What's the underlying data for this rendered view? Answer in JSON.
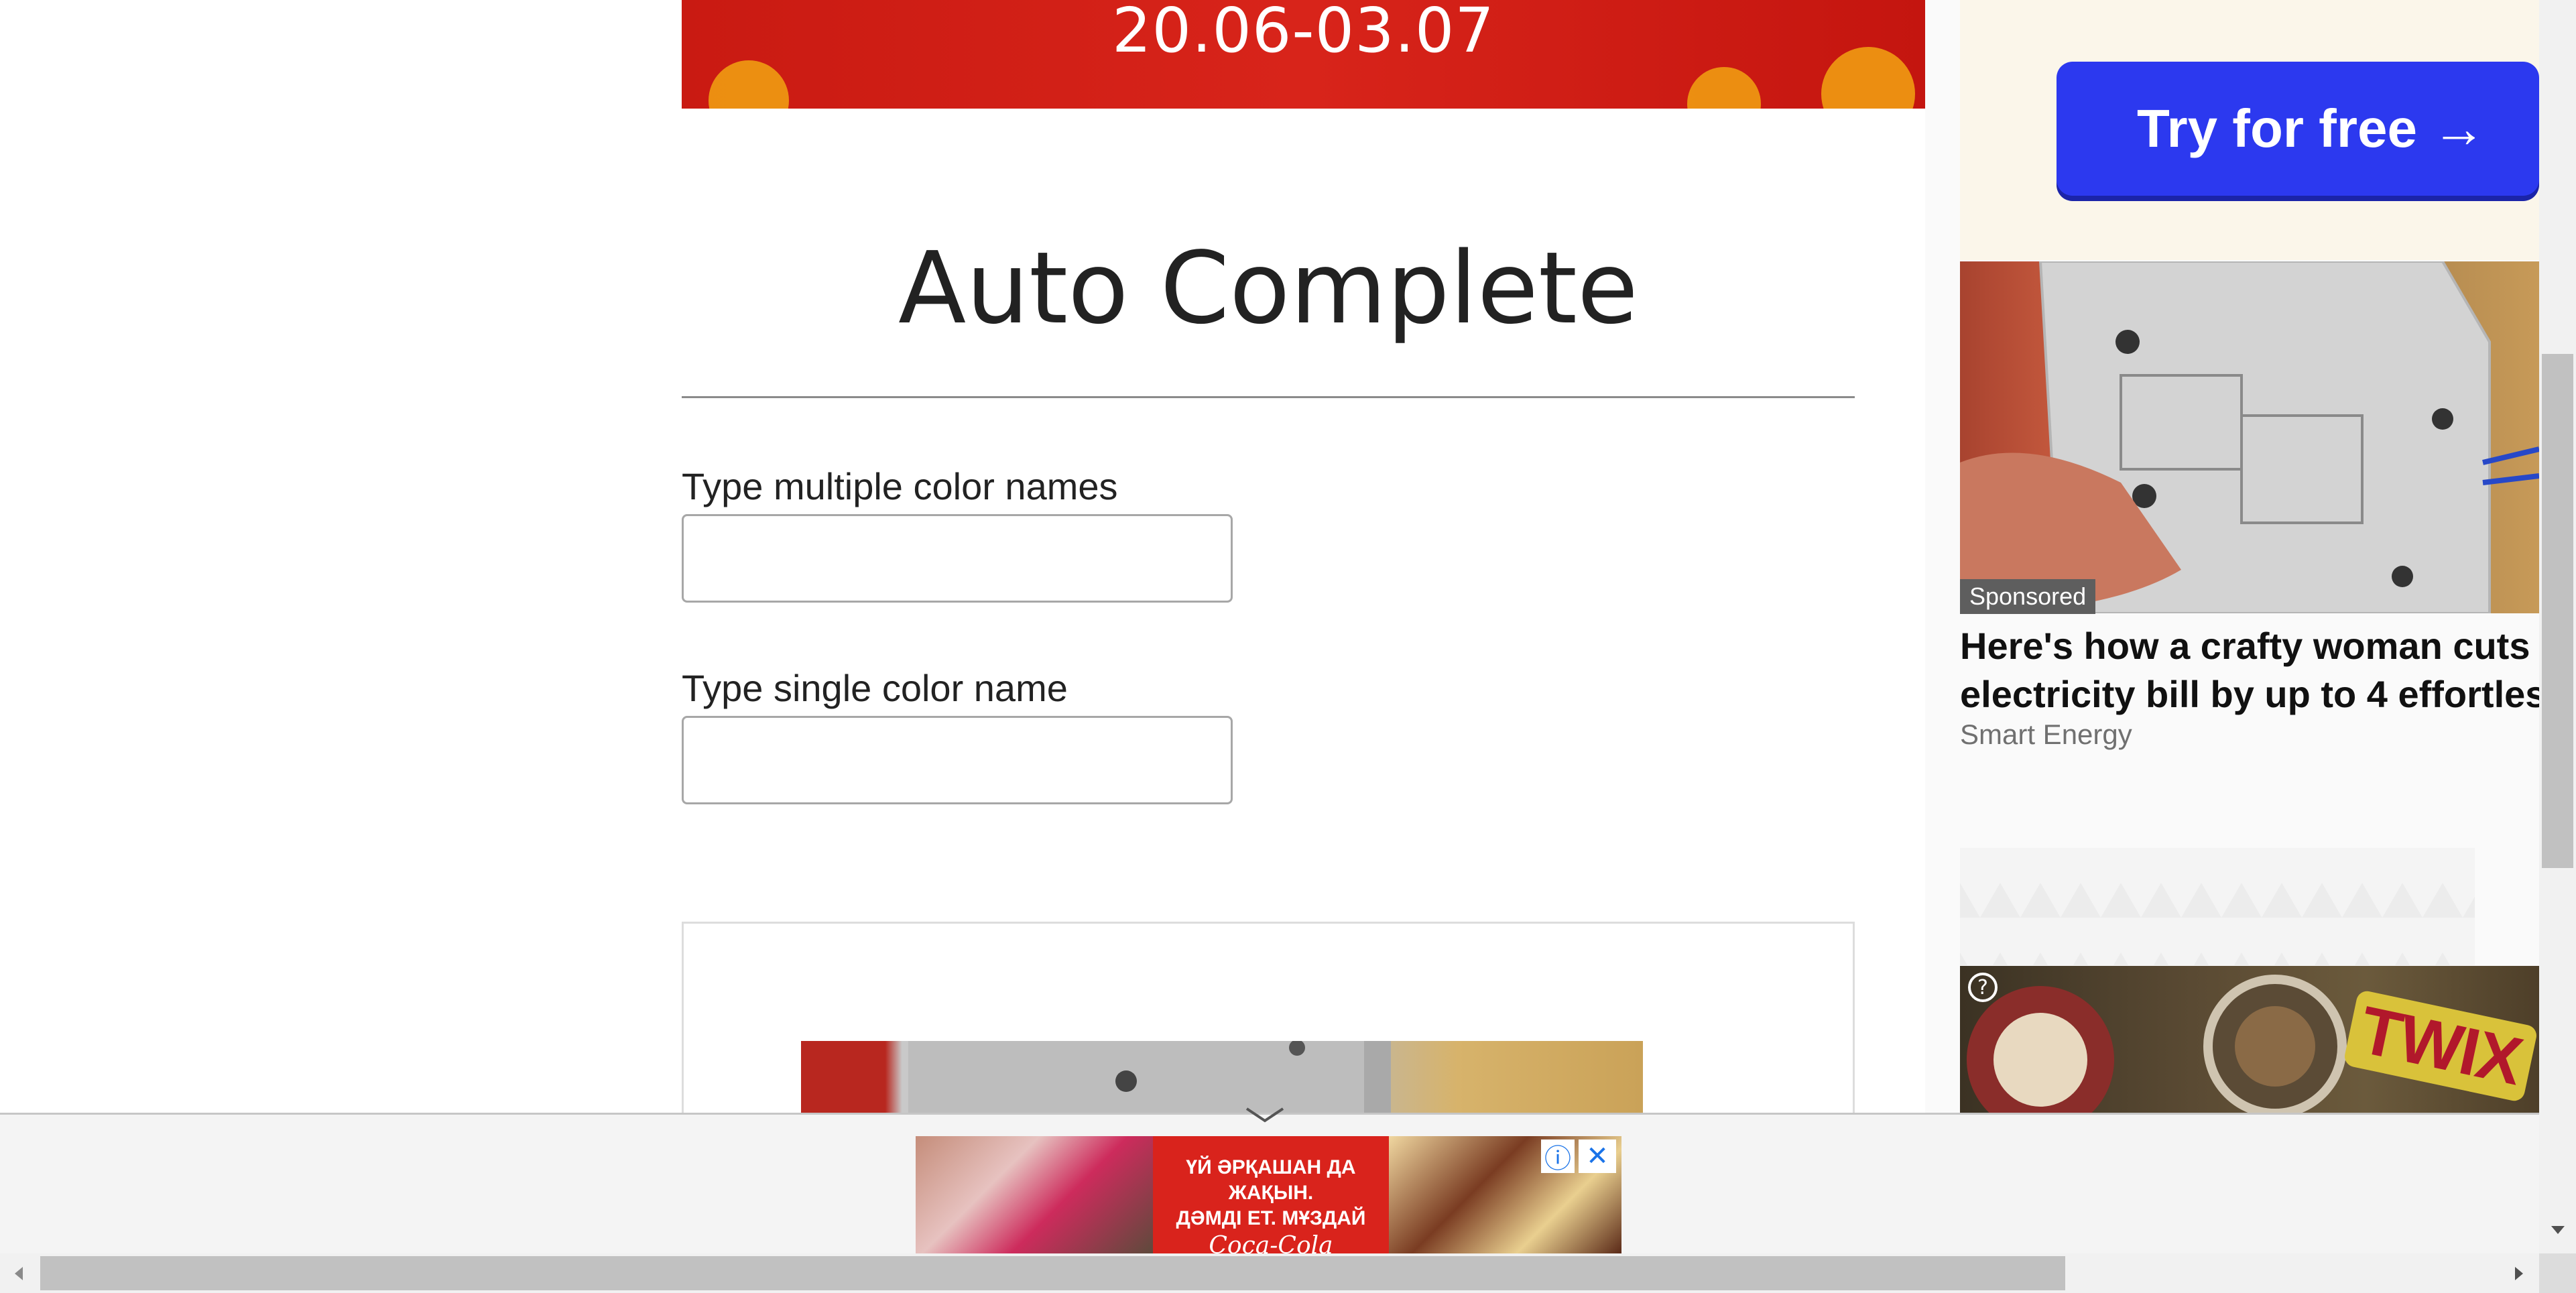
{
  "banner": {
    "dates": "20.06-03.07"
  },
  "page": {
    "title": "Auto Complete",
    "multiple_label": "Type multiple color names",
    "multiple_value": "",
    "single_label": "Type single color name",
    "single_value": ""
  },
  "sidebar": {
    "cta_label": "Try for free →",
    "sponsored_badge": "Sponsored",
    "headline_line1": "Here's how a crafty woman cuts",
    "headline_line2": "electricity bill by up to 4 effortles",
    "source": "Smart Energy",
    "twix_logo": "TWIX",
    "help_glyph": "?"
  },
  "bottom_ad": {
    "line1": "ҮЙ ӘРҚАШАН ДА ЖАҚЫН.",
    "line2": "ДӘМДІ ЕТ. МҰЗДАЙ",
    "brand": "Coca-Cola",
    "info_glyph": "ⓘ",
    "close_glyph": "✕"
  },
  "colors": {
    "banner_red": "#d8241a",
    "cta_blue": "#2c39ef",
    "scroll_thumb": "#c1c1c1"
  }
}
